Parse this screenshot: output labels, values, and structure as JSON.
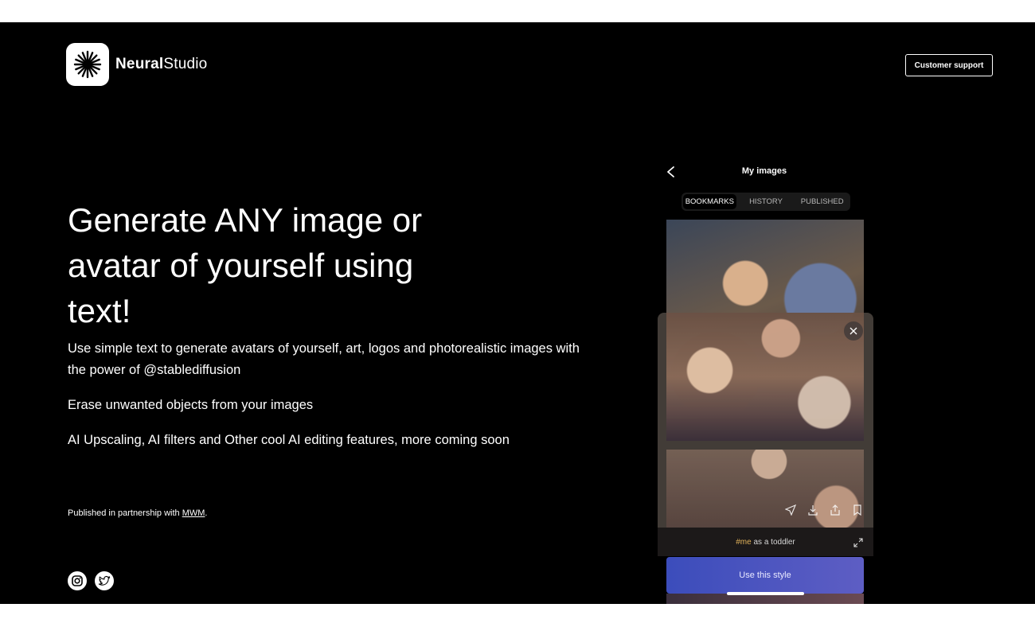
{
  "brand": {
    "name_bold": "Neural",
    "name_light": "Studio"
  },
  "header": {
    "support_label": "Customer support"
  },
  "hero": {
    "title": "Generate ANY image or avatar of yourself using text!",
    "features": [
      "Use simple text to generate avatars of yourself, art, logos and photorealistic images with the power of @stablediffusion",
      "Erase unwanted objects from your images",
      "AI Upscaling, AI filters and Other cool AI editing features, more coming soon"
    ],
    "partner_prefix": "Published in partnership with ",
    "partner_link": "MWM",
    "partner_suffix": "."
  },
  "social": {
    "icons": [
      "instagram-icon",
      "twitter-icon"
    ]
  },
  "phone": {
    "title": "My images",
    "tabs": [
      "BOOKMARKS",
      "HISTORY",
      "PUBLISHED"
    ],
    "active_tab": "BOOKMARKS",
    "prompt_tag": "#me",
    "prompt_rest": " as a toddler",
    "use_style_label": "Use this style"
  },
  "colors": {
    "background": "#000000",
    "text": "#ffffff",
    "prompt_tag": "#e2b35b",
    "button_accent": "#5a64e0"
  }
}
